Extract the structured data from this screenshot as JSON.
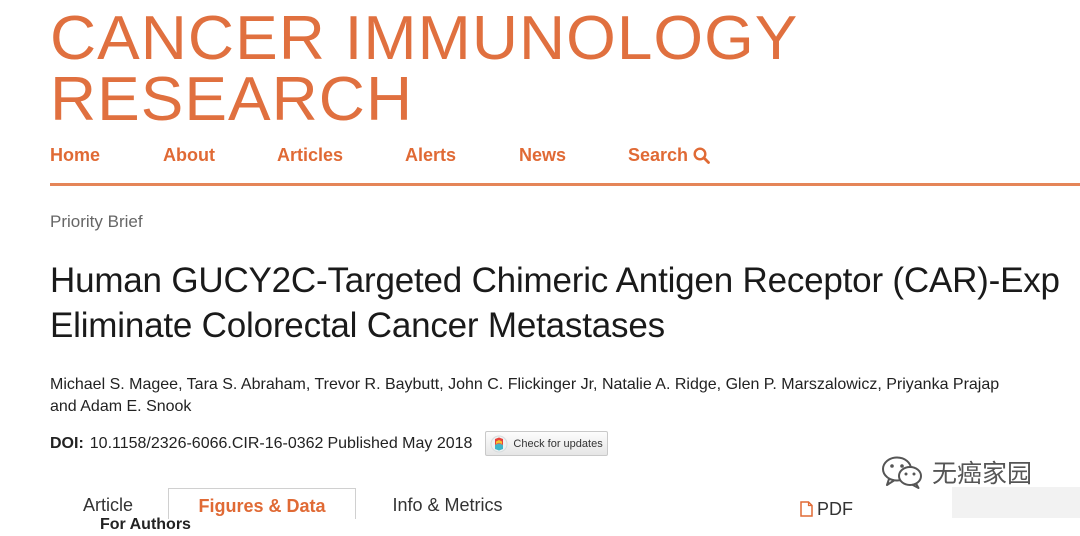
{
  "site": {
    "logo_line1": "CANCER IMMUNOLOGY",
    "logo_line2": "RESEARCH"
  },
  "nav": {
    "home": "Home",
    "about": "About",
    "articles": "Articles",
    "for_authors": "For Authors",
    "alerts": "Alerts",
    "news": "News",
    "search": "Search"
  },
  "article": {
    "type": "Priority Brief",
    "title_line1": "Human GUCY2C-Targeted Chimeric Antigen Receptor (CAR)-Exp",
    "title_line2": "Eliminate Colorectal Cancer Metastases",
    "authors_line1": "Michael S. Magee, Tara S. Abraham, Trevor R. Baybutt, John C. Flickinger Jr, Natalie A. Ridge, Glen P. Marszalowicz, Priyanka Prajap",
    "authors_line2": "and Adam E. Snook",
    "doi_label": "DOI:",
    "doi_value": "10.1158/2326-6066.CIR-16-0362",
    "published": "Published May 2018",
    "check_updates": "Check for updates"
  },
  "tabs": {
    "article": "Article",
    "figures": "Figures & Data",
    "info": "Info & Metrics",
    "pdf": "PDF"
  },
  "watermark": {
    "text": "无癌家园"
  },
  "colors": {
    "brand": "#e0703f",
    "rule": "#e58558"
  }
}
